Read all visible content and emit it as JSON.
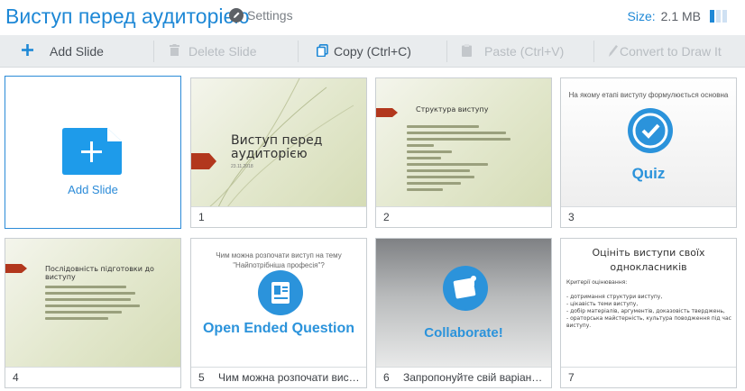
{
  "header": {
    "title": "Виступ перед аудиторією",
    "settings_label": "Settings",
    "size_label": "Size:",
    "size_value": "2.1 MB"
  },
  "toolbar": {
    "add_slide": "Add Slide",
    "delete_slide": "Delete Slide",
    "copy": "Copy (Ctrl+C)",
    "paste": "Paste (Ctrl+V)",
    "convert": "Convert to Draw It"
  },
  "add_card": {
    "label": "Add Slide"
  },
  "slides": [
    {
      "number": "1",
      "title": "",
      "thumb_title": "Виступ перед аудиторією",
      "thumb_sub": "23.11.2018"
    },
    {
      "number": "2",
      "title": "",
      "thumb_title": "Структура виступу"
    },
    {
      "number": "3",
      "title": "",
      "thumb_title": "На якому етапі виступу формулюється основна",
      "thumb_word": "Quiz"
    },
    {
      "number": "4",
      "title": "",
      "thumb_title": "Послідовність підготовки до виступу"
    },
    {
      "number": "5",
      "title": "Чим можна розпочати виступ н...",
      "thumb_title": "Чим можна розпочати виступ на тему \"Найпотрібніша професія\"?",
      "thumb_word": "Open Ended Question"
    },
    {
      "number": "6",
      "title": "Запропонуйте свій варіант відп...",
      "thumb_word": "Collaborate!"
    },
    {
      "number": "7",
      "title": "",
      "thumb_title": "Оцініть виступи своїх однокласників",
      "thumb_body": "Критерії оцінювання:\n\n- дотримання структури виступу,\n- цікавість теми виступу,\n- добір матеріалів, аргументів, доказовість тверджень,\n- ораторська майстерність, культура поводження під час виступу."
    }
  ],
  "colors": {
    "accent": "#1e88d6",
    "toolbar_bg": "#e9ecee",
    "slide_red": "#b2371d"
  }
}
